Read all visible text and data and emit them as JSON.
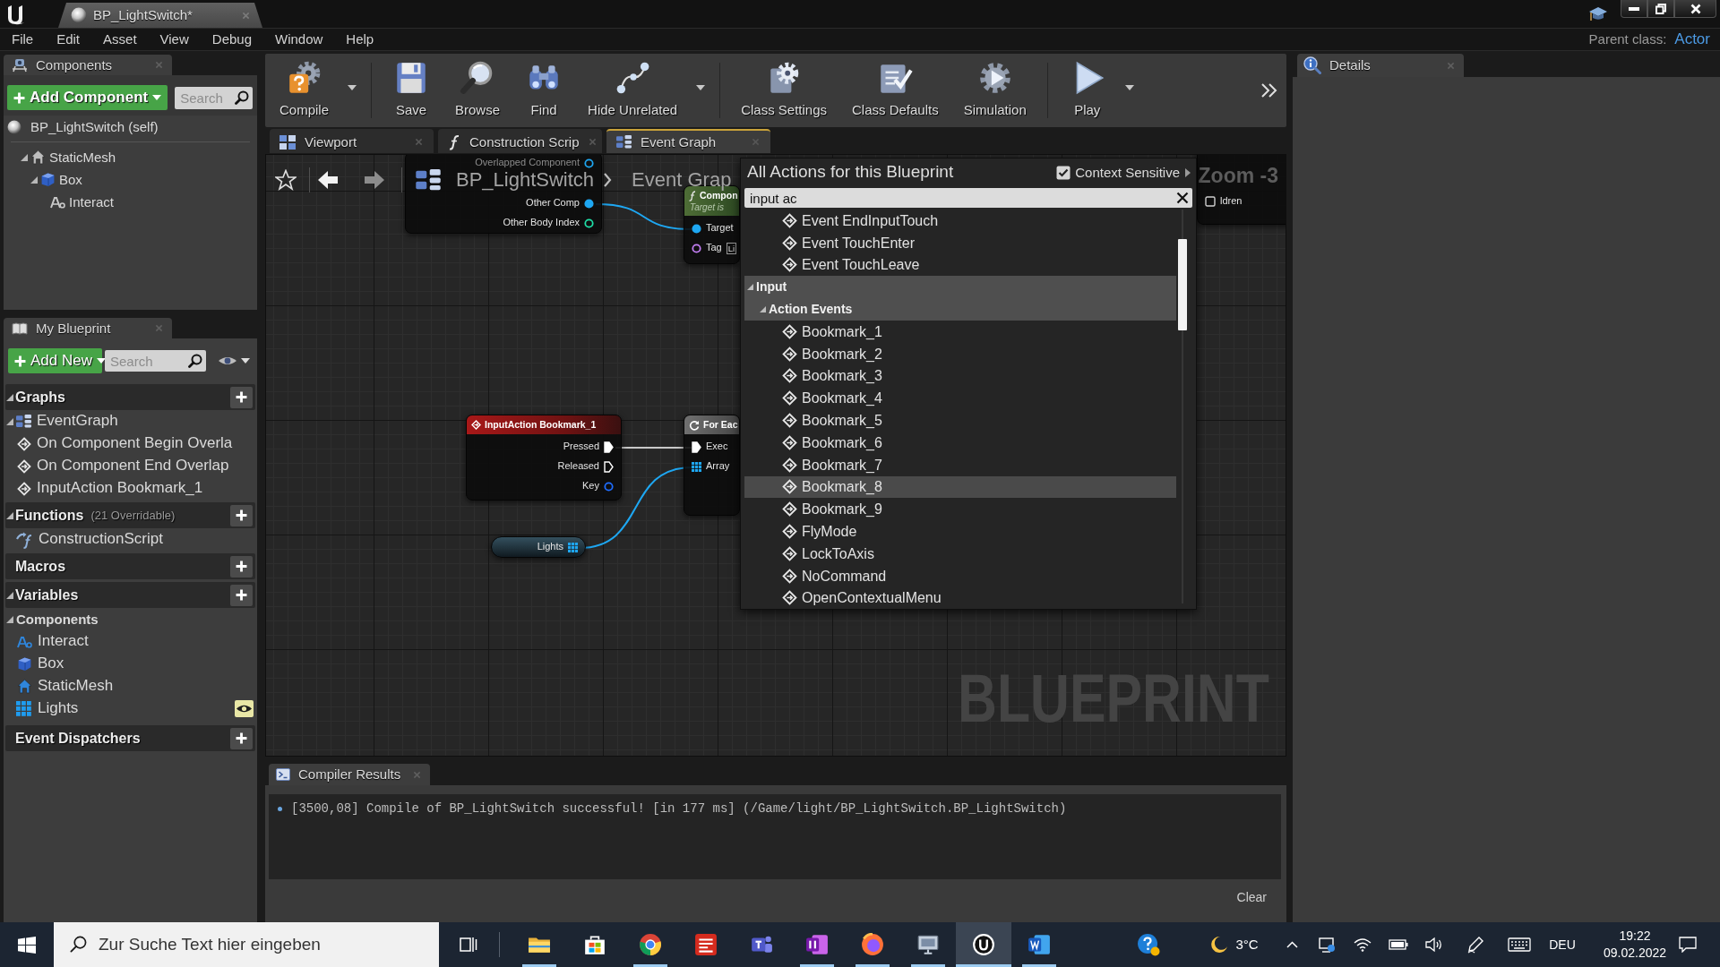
{
  "title_bar": {
    "document_tab": "BP_LightSwitch*"
  },
  "menu_bar": {
    "items": [
      "File",
      "Edit",
      "Asset",
      "View",
      "Debug",
      "Window",
      "Help"
    ],
    "parent_class_label": "Parent class:",
    "parent_class": "Actor"
  },
  "components_panel": {
    "tab": "Components",
    "add_button": "Add Component",
    "search": {
      "placeholder": "Search"
    },
    "root": "BP_LightSwitch (self)",
    "tree": [
      {
        "label": "StaticMesh",
        "kind": "mesh",
        "expanded": true,
        "children": [
          {
            "label": "Box",
            "kind": "box",
            "expanded": true,
            "children": [
              {
                "label": "Interact",
                "kind": "text"
              }
            ]
          }
        ]
      }
    ]
  },
  "my_blueprint": {
    "tab": "My Blueprint",
    "add_button": "Add New",
    "search": {
      "placeholder": "Search"
    },
    "sections": [
      {
        "title": "Graphs",
        "expanded": true,
        "items": [
          {
            "label": "EventGraph",
            "kind": "graph",
            "expanded": true,
            "children": [
              {
                "label": "On Component Begin Overla",
                "kind": "event"
              },
              {
                "label": "On Component End Overlap",
                "kind": "event"
              },
              {
                "label": "InputAction Bookmark_1",
                "kind": "event"
              }
            ]
          }
        ]
      },
      {
        "title": "Functions",
        "note": "(21 Overridable)",
        "expanded": true,
        "items": [
          {
            "label": "ConstructionScript",
            "kind": "function"
          }
        ]
      },
      {
        "title": "Macros"
      },
      {
        "title": "Variables",
        "expanded": true,
        "items": [
          {
            "label": "Components",
            "kind": "category",
            "expanded": true,
            "children": [
              {
                "label": "Interact",
                "kind": "text"
              },
              {
                "label": "Box",
                "kind": "box"
              },
              {
                "label": "StaticMesh",
                "kind": "mesh"
              }
            ]
          },
          {
            "label": "Lights",
            "kind": "array",
            "public": true
          }
        ]
      },
      {
        "title": "Event Dispatchers"
      }
    ]
  },
  "toolbar": {
    "groups": [
      {
        "buttons": [
          {
            "label": "Compile",
            "kind": "compile",
            "dropdown": true
          }
        ]
      },
      {
        "buttons": [
          {
            "label": "Save",
            "kind": "save",
            "dropdown": false
          },
          {
            "label": "Browse",
            "kind": "browse",
            "dropdown": false
          },
          {
            "label": "Find",
            "kind": "find",
            "dropdown": false
          },
          {
            "label": "Hide Unrelated",
            "kind": "hide_unrelated",
            "dropdown": true
          }
        ]
      },
      {
        "buttons": [
          {
            "label": "Class Settings",
            "kind": "class_settings",
            "dropdown": false
          },
          {
            "label": "Class Defaults",
            "kind": "class_defaults",
            "dropdown": false
          },
          {
            "label": "Simulation",
            "kind": "simulation",
            "dropdown": false
          }
        ]
      },
      {
        "buttons": [
          {
            "label": "Play",
            "kind": "play",
            "dropdown": true
          }
        ]
      }
    ]
  },
  "editor_tabs": [
    {
      "label": "Viewport",
      "kind": "viewport",
      "selected": false
    },
    {
      "label": "Construction Scrip",
      "kind": "function",
      "selected": false
    },
    {
      "label": "Event Graph",
      "kind": "graph",
      "selected": true
    }
  ],
  "graph": {
    "breadcrumb": [
      "BP_LightSwitch",
      "Event Grap"
    ],
    "zoom": "Zoom -3",
    "graph_type": "BLUEPRINT",
    "nodes": [
      {
        "outputs": [
          {
            "label": "Overlapped Component",
            "kind": "data",
            "connected": false,
            "color": "#1ea7f2"
          },
          {
            "label": "Other Comp",
            "kind": "data",
            "connected": true,
            "color": "#1ea7f2"
          },
          {
            "label": "Other Body Index",
            "kind": "data",
            "connected": false,
            "color": "#1fe0a8"
          }
        ]
      },
      {
        "kind": "function",
        "title": "Compon",
        "subtitle": "Target is",
        "inputs": [
          {
            "label": "Target",
            "kind": "data",
            "connected": true,
            "color": "#1ea7f2"
          },
          {
            "label": "Tag",
            "kind": "data",
            "connected": false,
            "color": "#c27ef2",
            "value": "Li"
          }
        ]
      },
      {
        "kind": "event",
        "title": "InputAction Bookmark_1",
        "outputs": [
          {
            "label": "Pressed",
            "kind": "exec",
            "connected": true
          },
          {
            "label": "Released",
            "kind": "exec",
            "connected": false
          },
          {
            "label": "Key",
            "kind": "data",
            "connected": false,
            "color": "#1f6dff"
          }
        ]
      },
      {
        "kind": "macro",
        "title": "For Eac",
        "inputs": [
          {
            "label": "Exec",
            "kind": "exec",
            "connected": true
          },
          {
            "label": "Array",
            "kind": "array",
            "connected": true,
            "color": "#1ea7f2"
          }
        ]
      },
      {
        "kind": "variable",
        "title": "Lights",
        "outputs": [
          {
            "kind": "array",
            "connected": true,
            "color": "#1ea7f2"
          }
        ]
      },
      {
        "inputs": [
          {
            "label": "ldren",
            "kind": "checkbox",
            "checked": false
          }
        ]
      }
    ]
  },
  "action_menu": {
    "title": "All Actions for this Blueprint",
    "context_sensitive": {
      "label": "Context Sensitive",
      "checked": true
    },
    "search": {
      "value": "input ac"
    },
    "results": [
      {
        "label": "Event EndInputTouch",
        "kind": "action",
        "selected": false
      },
      {
        "label": "Event TouchEnter",
        "kind": "action",
        "selected": false
      },
      {
        "label": "Event TouchLeave",
        "kind": "action",
        "selected": false
      },
      {
        "label": "Input",
        "kind": "category",
        "expanded": true,
        "selected": false,
        "children": [
          {
            "label": "Action Events",
            "kind": "category",
            "expanded": true,
            "selected": false,
            "children": [
              {
                "label": "Bookmark_1",
                "kind": "action",
                "selected": false
              },
              {
                "label": "Bookmark_2",
                "kind": "action",
                "selected": false
              },
              {
                "label": "Bookmark_3",
                "kind": "action",
                "selected": false
              },
              {
                "label": "Bookmark_4",
                "kind": "action",
                "selected": false
              },
              {
                "label": "Bookmark_5",
                "kind": "action",
                "selected": false
              },
              {
                "label": "Bookmark_6",
                "kind": "action",
                "selected": false
              },
              {
                "label": "Bookmark_7",
                "kind": "action",
                "selected": false
              },
              {
                "label": "Bookmark_8",
                "kind": "action",
                "selected": true
              },
              {
                "label": "Bookmark_9",
                "kind": "action",
                "selected": false
              },
              {
                "label": "FlyMode",
                "kind": "action",
                "selected": false
              },
              {
                "label": "LockToAxis",
                "kind": "action",
                "selected": false
              },
              {
                "label": "NoCommand",
                "kind": "action",
                "selected": false
              },
              {
                "label": "OpenContextualMenu",
                "kind": "action",
                "selected": false
              }
            ]
          }
        ]
      }
    ]
  },
  "compiler_results": {
    "tab": "Compiler Results",
    "messages": [
      "[3500,08] Compile of BP_LightSwitch successful! [in 177 ms] (/Game/light/BP_LightSwitch.BP_LightSwitch)"
    ],
    "clear_button": "Clear"
  },
  "details_panel": {
    "tab": "Details"
  },
  "taskbar": {
    "search": {
      "placeholder": "Zur Suche Text hier eingeben"
    },
    "apps": [
      {
        "kind": "explorer",
        "running": true,
        "selected": false
      },
      {
        "kind": "store",
        "running": false,
        "selected": false
      },
      {
        "kind": "chrome",
        "running": true,
        "selected": false
      },
      {
        "kind": "solidworks",
        "running": false,
        "selected": false
      },
      {
        "kind": "teams",
        "running": false,
        "selected": false
      },
      {
        "kind": "onenote",
        "running": true,
        "selected": false
      },
      {
        "kind": "firefox",
        "running": true,
        "selected": false
      },
      {
        "kind": "remote",
        "running": true,
        "selected": false
      },
      {
        "kind": "unreal",
        "running": true,
        "selected": true
      },
      {
        "kind": "word",
        "running": true,
        "selected": false
      }
    ],
    "tray": {
      "weather": "3°C",
      "language": "DEU",
      "time": "19:22",
      "date": "09.02.2022"
    }
  }
}
